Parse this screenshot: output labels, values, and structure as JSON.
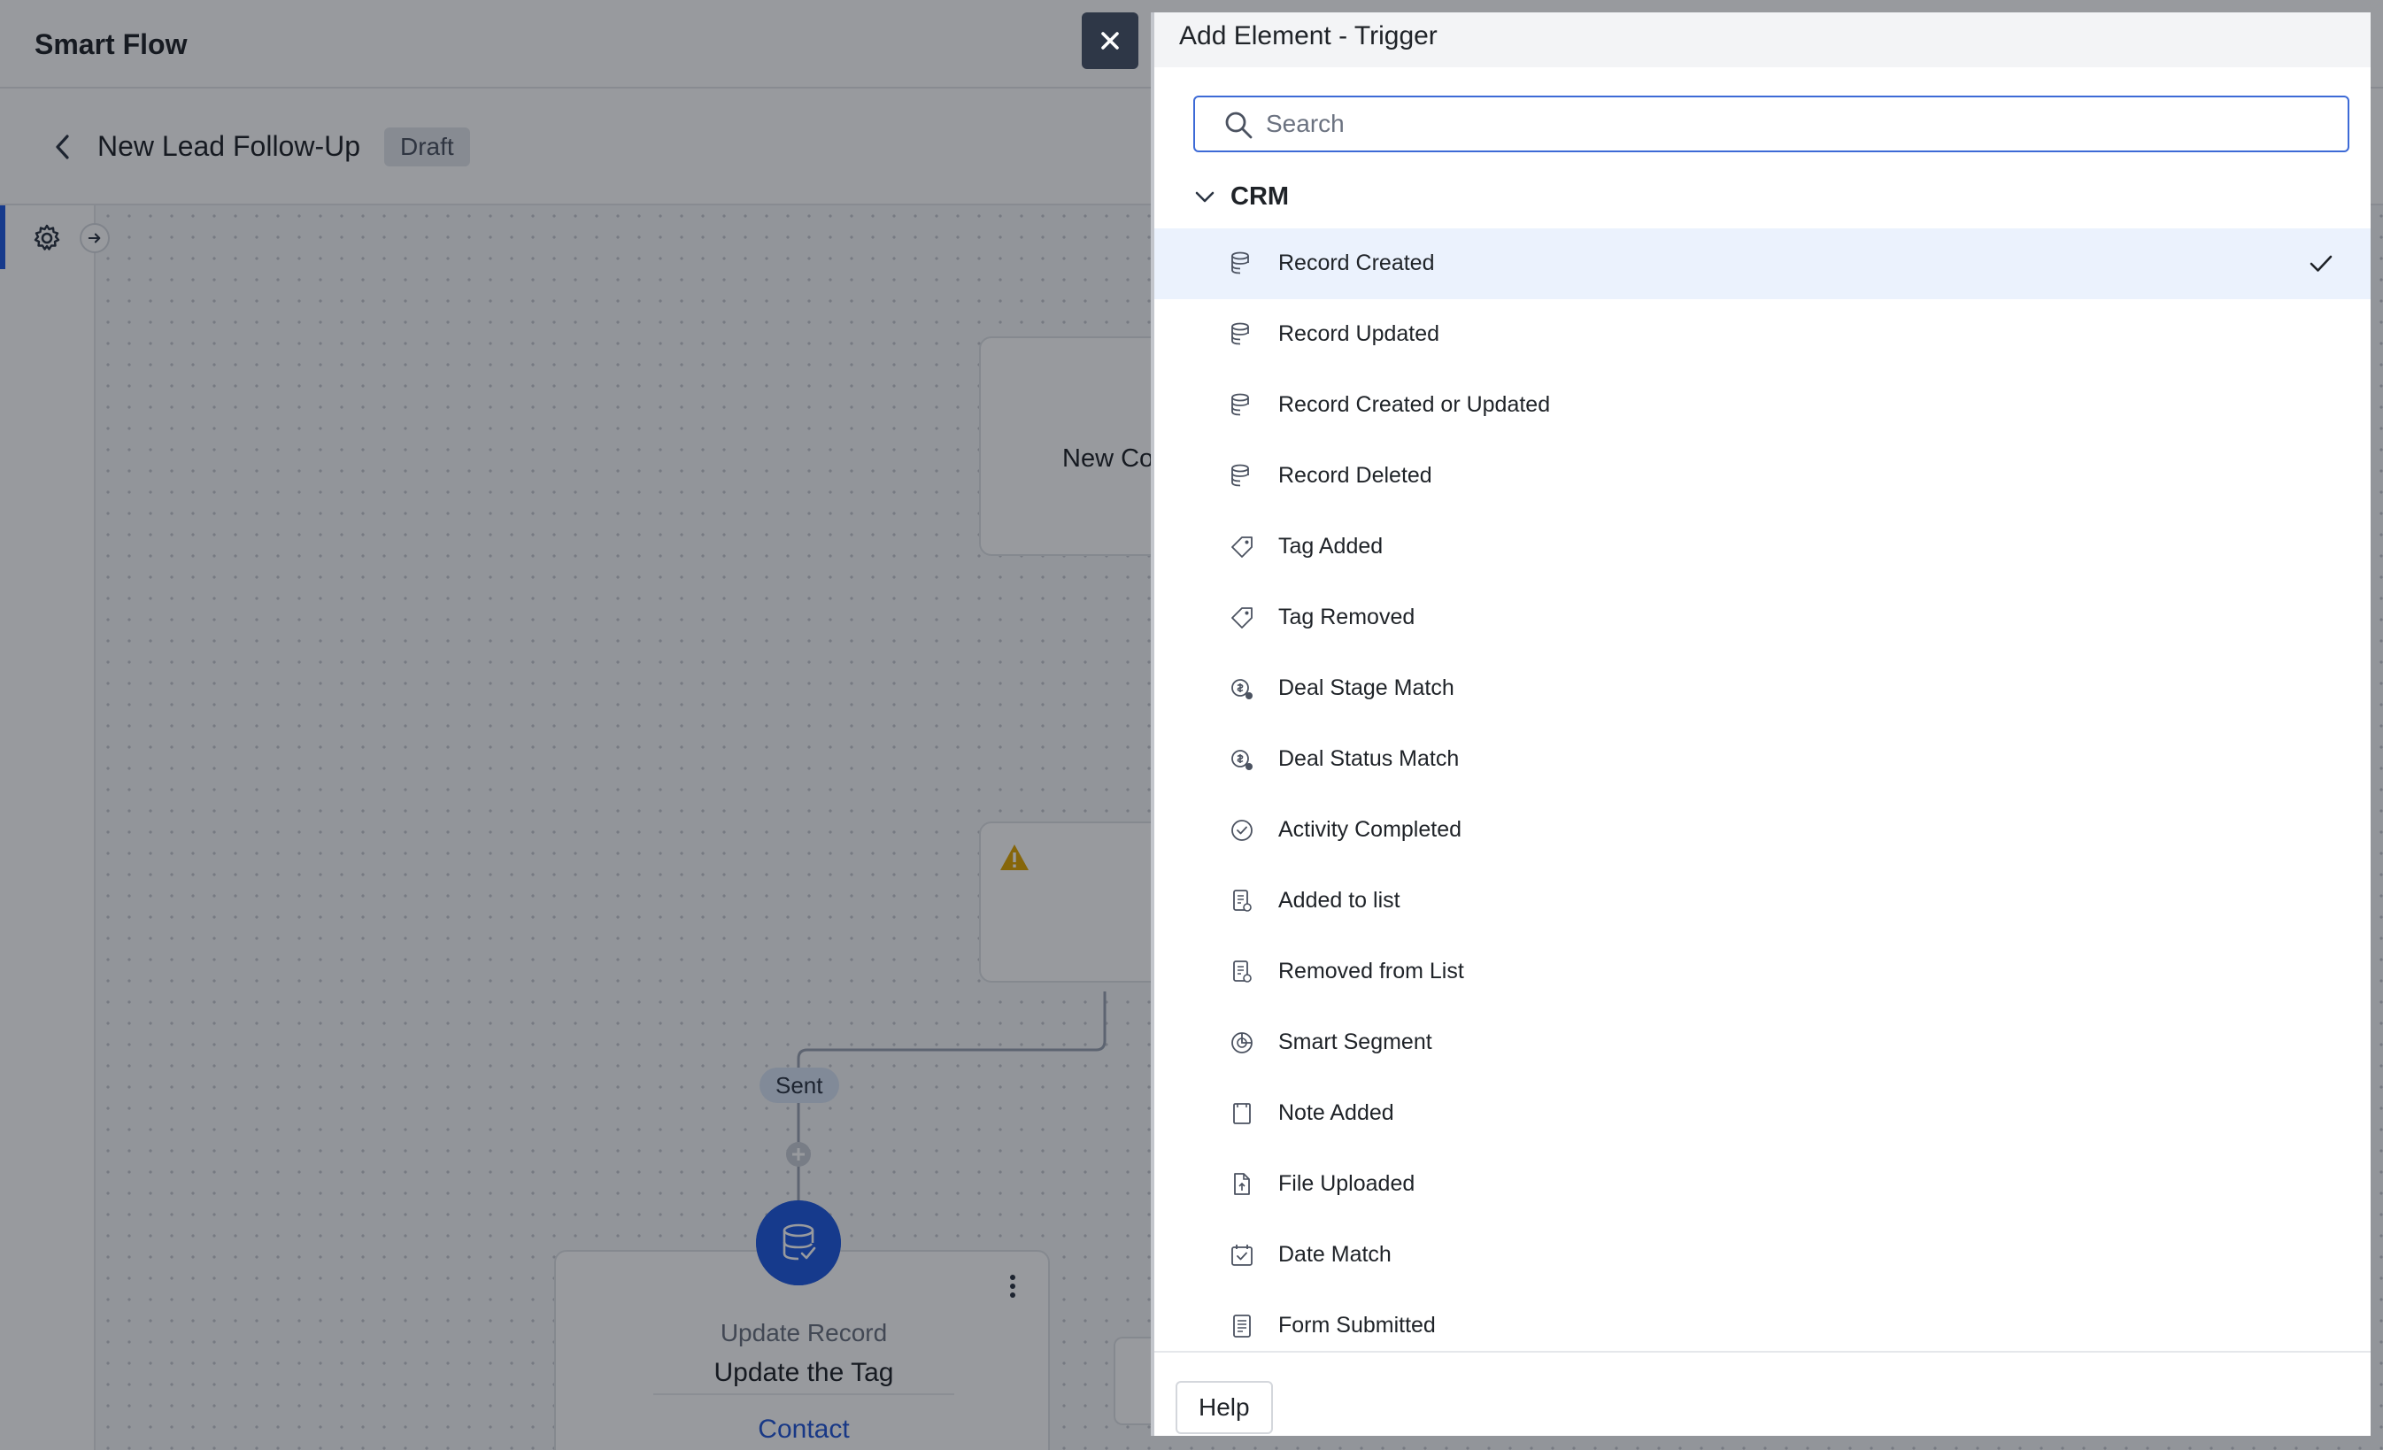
{
  "app": {
    "title": "Smart Flow",
    "flow_title": "New Lead Follow-Up",
    "status_badge": "Draft"
  },
  "canvas": {
    "node_top_text": "New Co",
    "connector_label": "Sent",
    "node_bottom": {
      "type": "Update Record",
      "title": "Update the Tag",
      "link": "Contact"
    }
  },
  "panel": {
    "title": "Add Element - Trigger",
    "search_placeholder": "Search",
    "search_value": "",
    "section_label": "CRM",
    "help_label": "Help",
    "items": [
      {
        "label": "Record Created",
        "icon": "database-plus-icon",
        "selected": true
      },
      {
        "label": "Record Updated",
        "icon": "database-edit-icon",
        "selected": false
      },
      {
        "label": "Record Created or Updated",
        "icon": "database-sync-icon",
        "selected": false
      },
      {
        "label": "Record Deleted",
        "icon": "database-x-icon",
        "selected": false
      },
      {
        "label": "Tag Added",
        "icon": "tag-icon",
        "selected": false
      },
      {
        "label": "Tag Removed",
        "icon": "tag-remove-icon",
        "selected": false
      },
      {
        "label": "Deal Stage Match",
        "icon": "deal-stage-icon",
        "selected": false
      },
      {
        "label": "Deal Status Match",
        "icon": "deal-status-icon",
        "selected": false
      },
      {
        "label": "Activity Completed",
        "icon": "check-circle-icon",
        "selected": false
      },
      {
        "label": "Added to list",
        "icon": "list-add-icon",
        "selected": false
      },
      {
        "label": "Removed from List",
        "icon": "list-remove-icon",
        "selected": false
      },
      {
        "label": "Smart Segment",
        "icon": "segment-icon",
        "selected": false
      },
      {
        "label": "Note Added",
        "icon": "note-icon",
        "selected": false
      },
      {
        "label": "File Uploaded",
        "icon": "file-upload-icon",
        "selected": false
      },
      {
        "label": "Date Match",
        "icon": "calendar-check-icon",
        "selected": false
      },
      {
        "label": "Form Submitted",
        "icon": "form-icon",
        "selected": false
      }
    ]
  },
  "colors": {
    "accent": "#1f5ae0",
    "selected_row": "#ebf2fd",
    "overlay": "#0a0e18",
    "warning": "#e0a500"
  }
}
